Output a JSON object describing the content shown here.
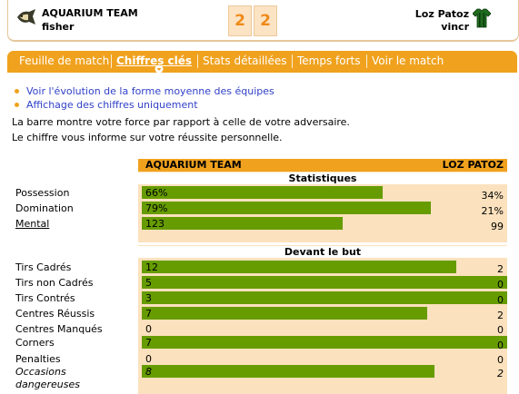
{
  "header": {
    "home_team": "AQUARIUM TEAM",
    "home_user": "fisher",
    "home_score": "2",
    "away_score": "2",
    "away_team": "Loz Patoz",
    "away_user": "vincr",
    "home_logo_icon": "fish-shield-icon",
    "away_logo_icon": "green-striped-shirt-icon"
  },
  "tabs": [
    {
      "label": "Feuille de match"
    },
    {
      "label": "Chiffres clés",
      "active": true
    },
    {
      "label": "Stats détaillées"
    },
    {
      "label": "Temps forts"
    },
    {
      "label": "Voir le match"
    }
  ],
  "links": {
    "evolution": "Voir l'évolution de la forme moyenne des équipes",
    "numbers_only": "Affichage des chiffres uniquement"
  },
  "info": {
    "line1": "La barre montre votre force par rapport à celle de votre adversaire.",
    "line2": "Le chiffre vous informe sur votre réussite personnelle."
  },
  "table": {
    "home_header": "AQUARIUM TEAM",
    "away_header": "LOZ PATOZ",
    "sections": [
      {
        "title": "Statistiques",
        "rows": [
          {
            "label": "Possession",
            "home": "66%",
            "away": "34%",
            "share": 0.66
          },
          {
            "label": "Domination",
            "home": "79%",
            "away": "21%",
            "share": 0.79
          },
          {
            "label": "Mental",
            "home": "123",
            "away": "99",
            "share": 0.55
          }
        ]
      },
      {
        "title": "Devant le but",
        "rows": [
          {
            "label": "Tirs Cadrés",
            "home": "12",
            "away": "2",
            "share": 0.86
          },
          {
            "label": "Tirs non Cadrés",
            "home": "5",
            "away": "0",
            "share": 1.0
          },
          {
            "label": "Tirs Contrés",
            "home": "3",
            "away": "0",
            "share": 1.0
          },
          {
            "label": "Centres Réussis",
            "home": "7",
            "away": "2",
            "share": 0.78
          },
          {
            "label": "Centres Manqués",
            "home": "0",
            "away": "0",
            "share": 0
          },
          {
            "label": "Corners",
            "home": "7",
            "away": "0",
            "share": 1.0
          },
          {
            "label": "Penalties",
            "home": "0",
            "away": "0",
            "share": 0
          },
          {
            "label": "Occasions dangereuses",
            "home": "8",
            "away": "2",
            "share": 0.8
          }
        ]
      }
    ]
  },
  "colors": {
    "accent": "#f0a21e",
    "bar": "#669c00",
    "band": "#fbe1bd",
    "link": "#3040c8",
    "score": "#ef8a1a"
  }
}
